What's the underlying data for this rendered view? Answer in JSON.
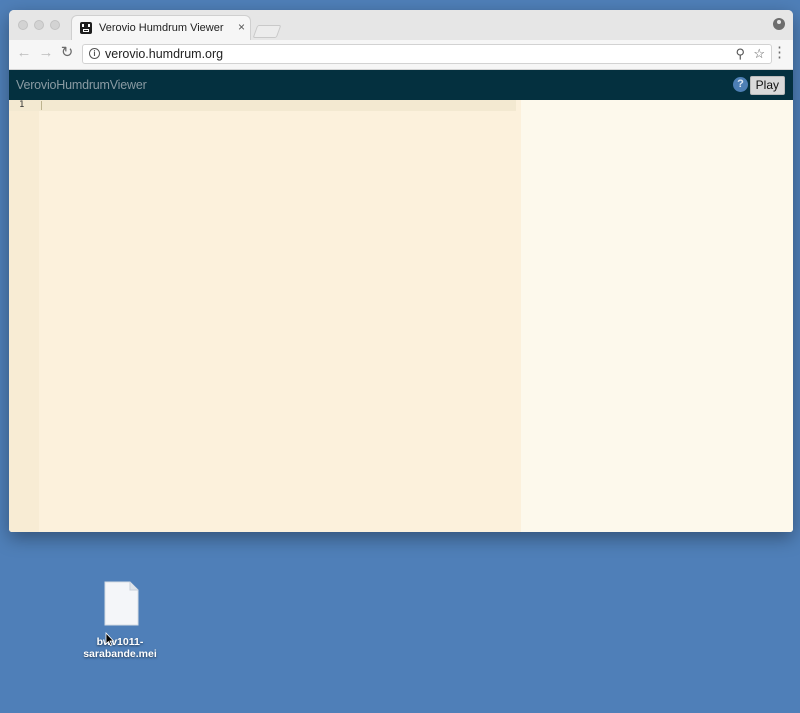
{
  "browser": {
    "tab_title": "Verovio Humdrum Viewer",
    "tab_close": "×",
    "url": "verovio.humdrum.org",
    "icons": [
      "back-icon",
      "forward-icon",
      "reload-icon",
      "info-icon",
      "zoom-icon",
      "star-icon",
      "menu-icon",
      "profile-icon"
    ]
  },
  "app": {
    "title": "VerovioHumdrumViewer",
    "help_label": "?",
    "play_label": "Play"
  },
  "editor": {
    "line_numbers": [
      "1"
    ],
    "content": ""
  },
  "desktop": {
    "file_name_line1": "bwv1011-",
    "file_name_line2": "sarabande.mei"
  },
  "colors": {
    "desktop": "#4f7fb8",
    "app_header": "#04303f",
    "editor_bg": "#fcf1dc",
    "notation_bg": "#fdf9ec"
  }
}
